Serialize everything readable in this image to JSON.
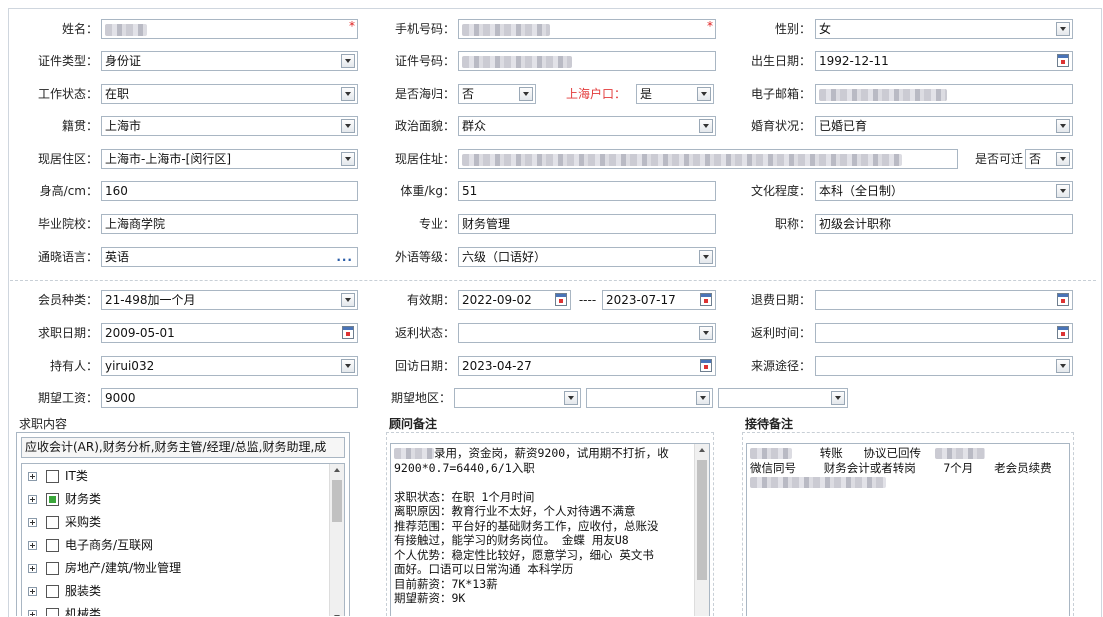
{
  "form": {
    "name": {
      "label": "姓名：",
      "required_mark": "*"
    },
    "phone": {
      "label": "手机号码：",
      "required_mark": "*"
    },
    "gender": {
      "label": "性别：",
      "value": "女"
    },
    "id_type": {
      "label": "证件类型：",
      "value": "身份证"
    },
    "id_number": {
      "label": "证件号码："
    },
    "birth_date": {
      "label": "出生日期：",
      "value": "1992-12-11"
    },
    "work_status": {
      "label": "工作状态：",
      "value": "在职"
    },
    "returnee": {
      "label": "是否海归：",
      "value": "否"
    },
    "shanghai_hukou": {
      "label": "上海户口：",
      "value": "是"
    },
    "email": {
      "label": "电子邮箱："
    },
    "native_place": {
      "label": "籍贯：",
      "value": "上海市"
    },
    "political_status": {
      "label": "政治面貌：",
      "value": "群众"
    },
    "marital_status": {
      "label": "婚育状况：",
      "value": "已婚已育"
    },
    "current_region": {
      "label": "现居住区：",
      "value": "上海市-上海市-[闵行区]"
    },
    "current_address": {
      "label": "现居住址："
    },
    "relocatable": {
      "label": "是否可迁",
      "value": "否"
    },
    "height": {
      "label": "身高/cm：",
      "value": "160"
    },
    "weight": {
      "label": "体重/kg：",
      "value": "51"
    },
    "education": {
      "label": "文化程度：",
      "value": "本科（全日制）"
    },
    "school": {
      "label": "毕业院校：",
      "value": "上海商学院"
    },
    "major": {
      "label": "专业：",
      "value": "财务管理"
    },
    "title": {
      "label": "职称：",
      "value": "初级会计职称"
    },
    "languages": {
      "label": "通晓语言：",
      "value": "英语",
      "more_icon": "..."
    },
    "language_level": {
      "label": "外语等级：",
      "value": "六级（口语好）"
    }
  },
  "membership": {
    "member_type": {
      "label": "会员种类：",
      "value": "21-498加一个月"
    },
    "validity": {
      "label": "有效期：",
      "start": "2022-09-02",
      "sep": "----",
      "end": "2023-07-17"
    },
    "refund_date": {
      "label": "退费日期："
    },
    "job_search_date": {
      "label": "求职日期：",
      "value": "2009-05-01"
    },
    "rebate_status": {
      "label": "返利状态："
    },
    "rebate_time": {
      "label": "返利时间："
    },
    "holder": {
      "label": "持有人：",
      "value": "yirui032"
    },
    "followup_date": {
      "label": "回访日期：",
      "value": "2023-04-27"
    },
    "source": {
      "label": "来源途径："
    },
    "expected_salary": {
      "label": "期望工资：",
      "value": "9000"
    },
    "expected_region": {
      "label": "期望地区："
    }
  },
  "job_content": {
    "title": "求职内容",
    "summary": "应收会计(AR),财务分析,财务主管/经理/总监,财务助理,成",
    "categories": [
      {
        "label": "IT类",
        "state": "unchecked"
      },
      {
        "label": "财务类",
        "state": "partial"
      },
      {
        "label": "采购类",
        "state": "unchecked"
      },
      {
        "label": "电子商务/互联网",
        "state": "unchecked"
      },
      {
        "label": "房地产/建筑/物业管理",
        "state": "unchecked"
      },
      {
        "label": "服装类",
        "state": "unchecked"
      },
      {
        "label": "机械类",
        "state": "unchecked"
      }
    ]
  },
  "consultant_notes": {
    "title": "顾问备注",
    "line1": "录用，资金岗，薪资9200，试用期不打折，收",
    "line2": "9200*0.7=6440,6/1入职",
    "line3": "求职状态：在职 1个月时间",
    "line4": "离职原因：教育行业不太好，个人对待遇不满意",
    "line5": "推荐范围：平台好的基础财务工作，应收付，总账没",
    "line6": "有接触过，能学习的财务岗位。 金蝶 用友U8",
    "line7": "个人优势：稳定性比较好，愿意学习，细心 英文书",
    "line8": "面好。口语可以日常沟通 本科学历",
    "line9": "目前薪资：7K*13薪",
    "line10": "期望薪资：9K"
  },
  "reception_notes": {
    "title": "接待备注",
    "line1_a": "转账",
    "line1_b": "协议已回传",
    "line2": "微信同号    财务会计或者转岗    7个月   老会员续费"
  },
  "colors": {
    "border": "#a9b6c3",
    "required": "#e02020",
    "hukou_label": "#e23a3a",
    "check_green": "#3aa63a"
  }
}
